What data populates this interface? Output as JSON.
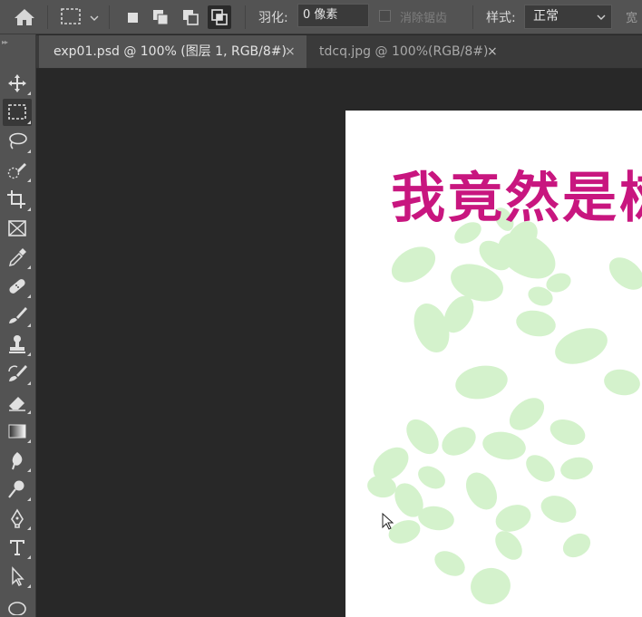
{
  "options_bar": {
    "feather_label": "羽化:",
    "feather_value": "0 像素",
    "antialias_label": "消除锯齿",
    "style_label": "样式:",
    "style_value": "正常",
    "width_label": "宽"
  },
  "tabs": [
    {
      "label": "exp01.psd @ 100% (图层 1, RGB/8#)",
      "close": "×",
      "active": true
    },
    {
      "label": "tdcq.jpg @ 100%(RGB/8#)",
      "close": "×",
      "active": false
    }
  ],
  "document": {
    "text": "我竟然是树",
    "text_color": "#c8167f",
    "leaf_color": "#d4f2cc"
  },
  "tools": [
    "move-tool",
    "rectangular-marquee-tool",
    "lasso-tool",
    "quick-selection-tool",
    "crop-tool",
    "frame-tool",
    "eyedropper-tool",
    "healing-brush-tool",
    "brush-tool",
    "clone-stamp-tool",
    "history-brush-tool",
    "eraser-tool",
    "gradient-tool",
    "blur-tool",
    "dodge-tool",
    "pen-tool",
    "type-tool",
    "path-selection-tool",
    "ellipse-tool"
  ]
}
